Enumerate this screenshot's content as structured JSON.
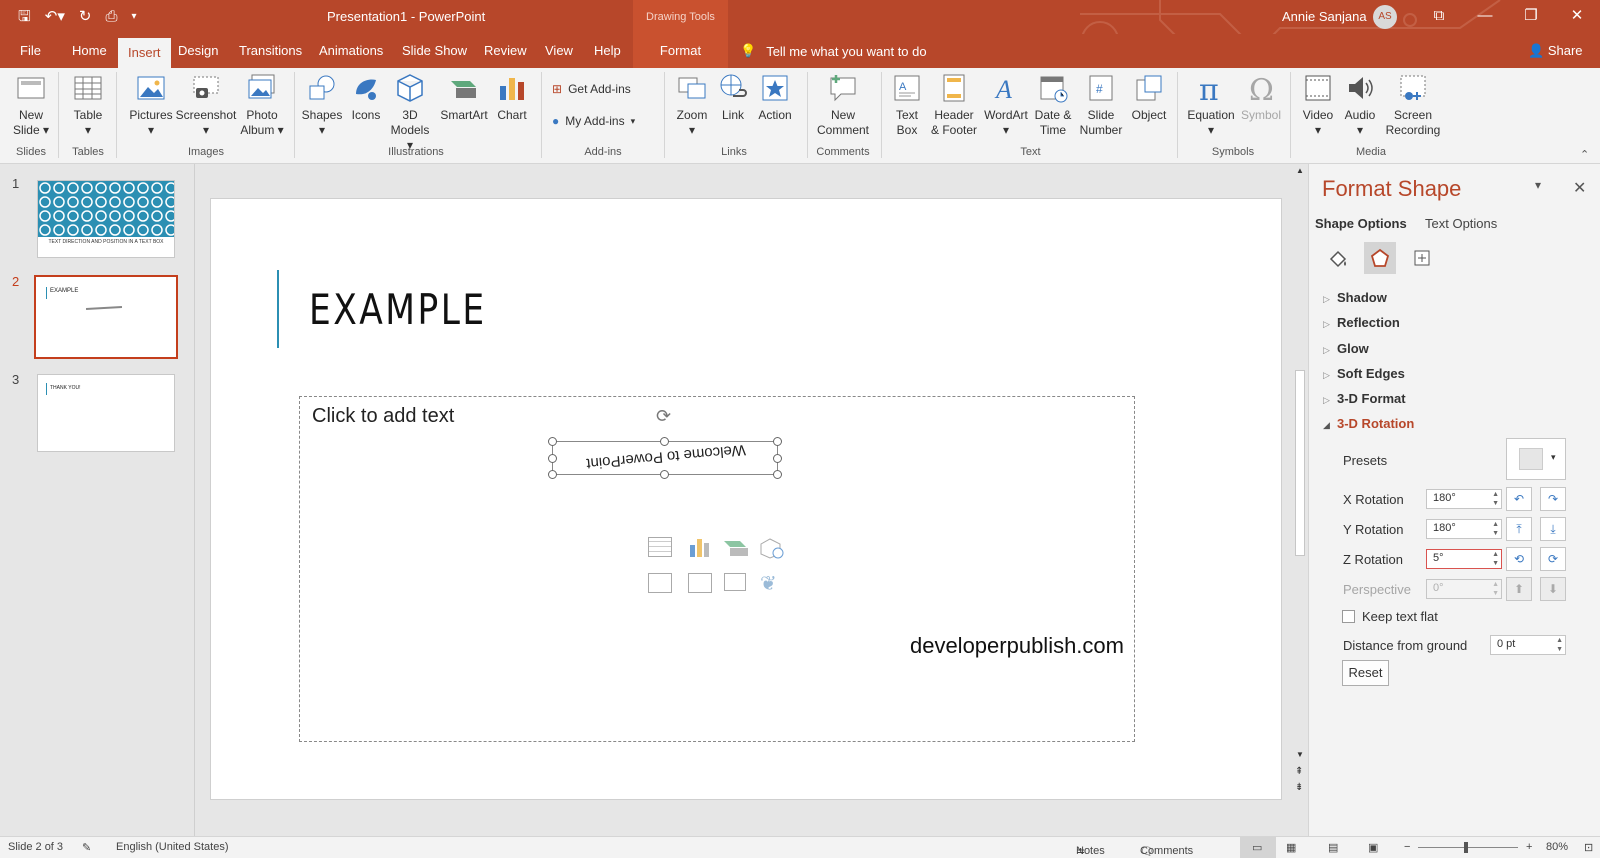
{
  "app": {
    "title": "Presentation1  -  PowerPoint",
    "context_header": "Drawing Tools",
    "user_name": "Annie Sanjana",
    "user_initials": "AS",
    "accent_color": "#b7472a"
  },
  "tabs": [
    "File",
    "Home",
    "Insert",
    "Design",
    "Transitions",
    "Animations",
    "Slide Show",
    "Review",
    "View",
    "Help",
    "Format"
  ],
  "active_tab": "Insert",
  "tell_me": "Tell me what you want to do",
  "share": "Share",
  "ribbon": {
    "new_slide": "New",
    "new_slide_2": "Slide",
    "table": "Table",
    "pictures": "Pictures",
    "screenshot": "Screenshot",
    "photo_album": "Photo",
    "photo_album_2": "Album",
    "shapes": "Shapes",
    "icons": "Icons",
    "models_3d": "3D",
    "models_3d_2": "Models",
    "smartart": "SmartArt",
    "chart": "Chart",
    "get_addins": "Get Add-ins",
    "my_addins": "My Add-ins",
    "zoom": "Zoom",
    "link": "Link",
    "action": "Action",
    "new_comment": "New",
    "new_comment_2": "Comment",
    "text_box": "Text",
    "text_box_2": "Box",
    "header_footer": "Header",
    "header_footer_2": "& Footer",
    "wordart": "WordArt",
    "date_time": "Date &",
    "date_time_2": "Time",
    "slide_number": "Slide",
    "slide_number_2": "Number",
    "object": "Object",
    "equation": "Equation",
    "symbol": "Symbol",
    "video": "Video",
    "audio": "Audio",
    "screen_recording": "Screen",
    "screen_recording_2": "Recording",
    "groups": {
      "slides": "Slides",
      "tables": "Tables",
      "images": "Images",
      "illustrations": "Illustrations",
      "addins": "Add-ins",
      "links": "Links",
      "comments": "Comments",
      "text": "Text",
      "symbols": "Symbols",
      "media": "Media"
    }
  },
  "thumbnails": [
    {
      "num": "1",
      "caption": "TEXT DIRECTION AND POSITION IN A TEXT BOX"
    },
    {
      "num": "2",
      "caption": "EXAMPLE"
    },
    {
      "num": "3",
      "caption": "THANK YOU!"
    }
  ],
  "slide": {
    "title": "EXAMPLE",
    "placeholder": "Click to add text",
    "rotated_text": "Welcome to PowerPoint",
    "footer_text": "developerpublish.com"
  },
  "format_pane": {
    "title": "Format Shape",
    "tab_shape": "Shape Options",
    "tab_text": "Text Options",
    "sections": [
      "Shadow",
      "Reflection",
      "Glow",
      "Soft Edges",
      "3-D Format",
      "3-D Rotation"
    ],
    "presets_label": "Presets",
    "x_rotation_label": "X Rotation",
    "x_rotation_value": "180°",
    "y_rotation_label": "Y Rotation",
    "y_rotation_value": "180°",
    "z_rotation_label": "Z Rotation",
    "z_rotation_value": "5°",
    "perspective_label": "Perspective",
    "perspective_value": "0°",
    "keep_flat_label": "Keep text flat",
    "distance_label": "Distance from ground",
    "distance_value": "0 pt",
    "reset_label": "Reset"
  },
  "status": {
    "slide_info": "Slide 2 of 3",
    "language": "English (United States)",
    "notes": "Notes",
    "comments": "Comments",
    "zoom": "80%"
  }
}
